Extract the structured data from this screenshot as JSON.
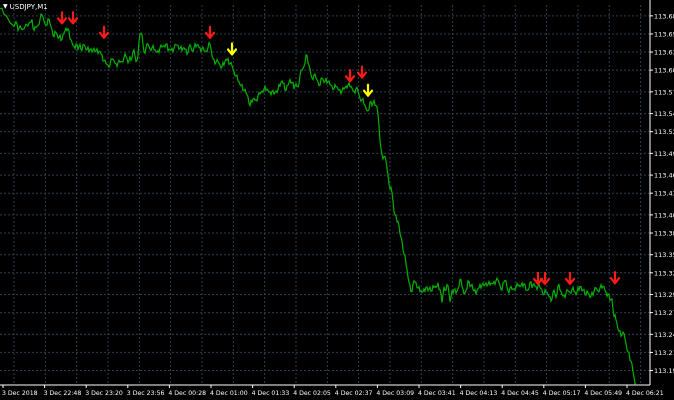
{
  "symbol": "USDJPY,M1",
  "chart_data": {
    "type": "line",
    "title": "USDJPY,M1",
    "xlabel": "",
    "ylabel": "",
    "ylim": [
      113.17,
      113.695
    ],
    "yticks": [
      "113.680",
      "113.655",
      "113.630",
      "113.605",
      "113.575",
      "113.545",
      "113.520",
      "113.490",
      "113.460",
      "113.435",
      "113.405",
      "113.380",
      "113.350",
      "113.325",
      "113.295",
      "113.270",
      "113.240",
      "113.215",
      "113.190"
    ],
    "y_tick_values": [
      113.68,
      113.655,
      113.63,
      113.605,
      113.575,
      113.545,
      113.52,
      113.49,
      113.46,
      113.435,
      113.405,
      113.38,
      113.35,
      113.325,
      113.295,
      113.27,
      113.24,
      113.215,
      113.19
    ],
    "xticks": [
      "3 Dec 2018",
      "3 Dec 22:48",
      "3 Dec 23:20",
      "3 Dec 23:56",
      "4 Dec 00:28",
      "4 Dec 01:00",
      "4 Dec 01:33",
      "4 Dec 02:05",
      "4 Dec 02:37",
      "4 Dec 03:09",
      "4 Dec 03:41",
      "4 Dec 04:13",
      "4 Dec 04:45",
      "4 Dec 05:17",
      "4 Dec 05:49",
      "4 Dec 06:21"
    ],
    "grid": true,
    "colors": {
      "background": "#000000",
      "grid": "#2c3e50",
      "price_line": "#00b200",
      "sell_signal": "#ff1a1a",
      "exit_signal": "#ffff00",
      "axis_text": "#ffffff"
    },
    "x_unit": "minute index (M1 bars from first bar on chart)",
    "series": [
      {
        "values_x": [
          0,
          4,
          8,
          12,
          16,
          18,
          20,
          24,
          28,
          30,
          32,
          34,
          36,
          38,
          40,
          42,
          44,
          46,
          48,
          50,
          52,
          54,
          56,
          58,
          60,
          62,
          64,
          66,
          68,
          70,
          72,
          74,
          76,
          78,
          80,
          82,
          84,
          86,
          88,
          90,
          92,
          94,
          96,
          98,
          100,
          102,
          104,
          106,
          108,
          110,
          112,
          114,
          116,
          118,
          120,
          122,
          124,
          126,
          128,
          130,
          132,
          134,
          136,
          138,
          140,
          142,
          144,
          146,
          148,
          150,
          152,
          154,
          156,
          158,
          160,
          162,
          164,
          166,
          168,
          170,
          172,
          174,
          176,
          178,
          180,
          182,
          184,
          186,
          188,
          190,
          192,
          194,
          196,
          198,
          200,
          202,
          204,
          206,
          208,
          210,
          212,
          214,
          216,
          218,
          220,
          222,
          224,
          226,
          228,
          230,
          232,
          234,
          236,
          238,
          240,
          242,
          244,
          246,
          248,
          250,
          252,
          254,
          256,
          258,
          260,
          262,
          264,
          266,
          268,
          270,
          272,
          274,
          276,
          278,
          280,
          282,
          284,
          286,
          288,
          290,
          292,
          294,
          296,
          298,
          300,
          302,
          304,
          306,
          308,
          310,
          312,
          314,
          316,
          318,
          320,
          322,
          324,
          326,
          328,
          330,
          332,
          334,
          336,
          338,
          340,
          342,
          344,
          346,
          348,
          350,
          352,
          354,
          356,
          358,
          360,
          362,
          364,
          366,
          368,
          370,
          372,
          374,
          376,
          378,
          380,
          382,
          384,
          386,
          388,
          390,
          392,
          394,
          396,
          398,
          400,
          402,
          404,
          406,
          408,
          410,
          412,
          414,
          416,
          418,
          420,
          422,
          424,
          426,
          428,
          430,
          432,
          434,
          436,
          438,
          440,
          442,
          444,
          446,
          448,
          450,
          452,
          454,
          456,
          458,
          460,
          462,
          464,
          466,
          468,
          470,
          472,
          474,
          476,
          478,
          480,
          482,
          484,
          486,
          488,
          490,
          492,
          494,
          496,
          498,
          500,
          502,
          504,
          506,
          508,
          510,
          512,
          514,
          516,
          518,
          520,
          522,
          524,
          526,
          528,
          530,
          532,
          534,
          536,
          538,
          540,
          542,
          544,
          546,
          548,
          550,
          552,
          554,
          556,
          558,
          560,
          562,
          564,
          566,
          568,
          570,
          572,
          574,
          576,
          578,
          580,
          582,
          584,
          586,
          588,
          590,
          592,
          594,
          596,
          598,
          600,
          602,
          604,
          606,
          608,
          610,
          612,
          614,
          616,
          618,
          620,
          622,
          624,
          626,
          628,
          630,
          632,
          634,
          636,
          638,
          640,
          642,
          644
        ],
        "values": [
          113.69,
          113.682,
          113.676,
          113.668,
          113.672,
          113.66,
          113.666,
          113.662,
          113.666,
          113.671,
          113.675,
          113.66,
          113.664,
          113.667,
          113.675,
          113.681,
          113.673,
          113.667,
          113.676,
          113.669,
          113.661,
          113.651,
          113.657,
          113.649,
          113.654,
          113.647,
          113.656,
          113.663,
          113.662,
          113.648,
          113.643,
          113.638,
          113.641,
          113.634,
          113.641,
          113.632,
          113.64,
          113.633,
          113.637,
          113.633,
          113.63,
          113.635,
          113.632,
          113.628,
          113.631,
          113.626,
          113.618,
          113.614,
          113.612,
          113.612,
          113.62,
          113.618,
          113.614,
          113.615,
          113.616,
          113.617,
          113.622,
          113.624,
          113.615,
          113.624,
          113.622,
          113.633,
          113.617,
          113.625,
          113.655,
          113.654,
          113.63,
          113.636,
          113.641,
          113.634,
          113.636,
          113.633,
          113.63,
          113.632,
          113.636,
          113.637,
          113.639,
          113.641,
          113.632,
          113.633,
          113.635,
          113.635,
          113.64,
          113.639,
          113.635,
          113.632,
          113.636,
          113.634,
          113.629,
          113.64,
          113.632,
          113.636,
          113.637,
          113.64,
          113.636,
          113.635,
          113.632,
          113.631,
          113.636,
          113.641,
          113.625,
          113.62,
          113.616,
          113.617,
          113.612,
          113.61,
          113.612,
          113.62,
          113.621,
          113.614,
          113.611,
          113.603,
          113.597,
          113.59,
          113.585,
          113.585,
          113.577,
          113.574,
          113.568,
          113.556,
          113.561,
          113.566,
          113.564,
          113.57,
          113.572,
          113.576,
          113.579,
          113.577,
          113.577,
          113.575,
          113.576,
          113.572,
          113.576,
          113.578,
          113.583,
          113.59,
          113.587,
          113.577,
          113.584,
          113.592,
          113.588,
          113.579,
          113.586,
          113.582,
          113.598,
          113.605,
          113.61,
          113.626,
          113.615,
          113.606,
          113.594,
          113.599,
          113.594,
          113.589,
          113.584,
          113.594,
          113.588,
          113.594,
          113.589,
          113.585,
          113.583,
          113.579,
          113.582,
          113.579,
          113.578,
          113.576,
          113.579,
          113.583,
          113.584,
          113.582,
          113.58,
          113.576,
          113.58,
          113.576,
          113.566,
          113.564,
          113.558,
          113.552,
          113.549,
          113.561,
          113.556,
          113.563,
          113.556,
          113.544,
          113.508,
          113.488,
          113.486,
          113.479,
          113.46,
          113.441,
          113.436,
          113.409,
          113.404,
          113.396,
          113.379,
          113.369,
          113.351,
          113.337,
          113.319,
          113.308,
          113.299,
          113.314,
          113.311,
          113.304,
          113.299,
          113.298,
          113.303,
          113.305,
          113.3,
          113.305,
          113.3,
          113.305,
          113.305,
          113.311,
          113.302,
          113.284,
          113.306,
          113.301,
          113.307,
          113.285,
          113.301,
          113.302,
          113.297,
          113.303,
          113.316,
          113.306,
          113.296,
          113.301,
          113.314,
          113.306,
          113.309,
          113.3,
          113.295,
          113.303,
          113.309,
          113.308,
          113.307,
          113.311,
          113.309,
          113.308,
          113.31,
          113.313,
          113.314,
          113.315,
          113.308,
          113.301,
          113.312,
          113.314,
          113.3,
          113.304,
          113.302,
          113.303,
          113.305,
          113.307,
          113.306,
          113.311,
          113.31,
          113.301,
          113.301,
          113.312,
          113.304,
          113.31,
          113.306,
          113.307,
          113.305,
          113.301,
          113.295,
          113.298,
          113.295,
          113.292,
          113.289,
          113.301,
          113.291,
          113.307,
          113.301,
          113.295,
          113.294,
          113.297,
          113.3,
          113.298,
          113.302,
          113.299,
          113.295,
          113.305,
          113.306,
          113.3,
          113.302,
          113.294,
          113.297,
          113.291,
          113.298,
          113.299,
          113.304,
          113.3,
          113.304,
          113.304,
          113.306,
          113.298,
          113.296,
          113.287,
          113.289,
          113.265,
          113.26,
          113.247,
          113.245,
          113.239,
          113.241,
          113.227,
          113.216,
          113.204,
          113.199,
          113.181,
          113.172
        ]
      }
    ],
    "signals": [
      {
        "type": "sell",
        "x": 62,
        "y": 113.66
      },
      {
        "type": "sell",
        "x": 73,
        "y": 113.66
      },
      {
        "type": "sell",
        "x": 104,
        "y": 113.64
      },
      {
        "type": "sell",
        "x": 210,
        "y": 113.64
      },
      {
        "type": "exit",
        "x": 232,
        "y": 113.617
      },
      {
        "type": "sell",
        "x": 350,
        "y": 113.58
      },
      {
        "type": "sell",
        "x": 362,
        "y": 113.585
      },
      {
        "type": "exit",
        "x": 368,
        "y": 113.56
      },
      {
        "type": "sell",
        "x": 538,
        "y": 113.3
      },
      {
        "type": "sell",
        "x": 545,
        "y": 113.3
      },
      {
        "type": "sell",
        "x": 570,
        "y": 113.3
      },
      {
        "type": "sell",
        "x": 615,
        "y": 113.301
      }
    ]
  }
}
